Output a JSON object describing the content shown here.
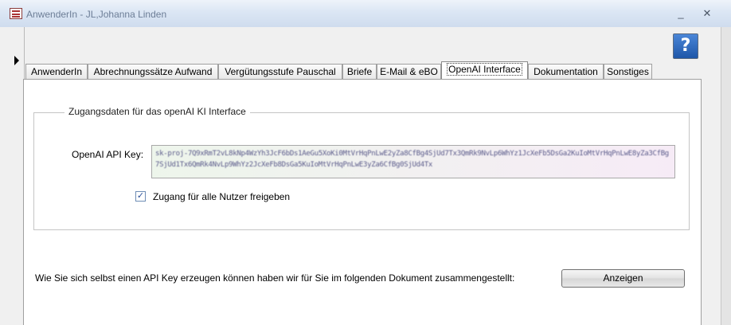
{
  "window": {
    "title": "AnwenderIn - JL,Johanna Linden",
    "minimize": "_",
    "close": "✕"
  },
  "help_button": {
    "label": "?"
  },
  "tabs": [
    {
      "label": "AnwenderIn",
      "active": false
    },
    {
      "label": "Abrechnungssätze Aufwand",
      "active": false
    },
    {
      "label": "Vergütungsstufe Pauschal",
      "active": false
    },
    {
      "label": "Briefe",
      "active": false
    },
    {
      "label": "E-Mail & eBO",
      "active": false
    },
    {
      "label": "OpenAI Interface",
      "active": true
    },
    {
      "label": "Dokumentation",
      "active": false
    },
    {
      "label": "Sonstiges",
      "active": false
    }
  ],
  "openai": {
    "group_caption": "Zugangsdaten für das openAI KI Interface",
    "api_key_label": "OpenAI API Key:",
    "api_key_value": "sk-proj-7Q9xRmT2vL8kNp4WzYh3JcF6bDs1AeGu5XoKi0MtVrHqPnLwE2yZa8CfBg4SjUd7Tx3QmRk9NvLp6WhYz1JcXeFb5DsGa2KuIoMtVrHqPnLwE8yZa3CfBg7SjUd1Tx6QmRk4NvLp9WhYz2JcXeFb8DsGa5KuIoMtVrHqPnLwE3yZa6CfBg0SjUd4Tx",
    "share_checkbox_checked": true,
    "share_checkbox_label": "Zugang für alle Nutzer freigeben",
    "info_text": "Wie Sie sich selbst einen API Key erzeugen können haben wir für Sie im folgenden Dokument zusammengestellt:",
    "show_button_label": "Anzeigen"
  }
}
